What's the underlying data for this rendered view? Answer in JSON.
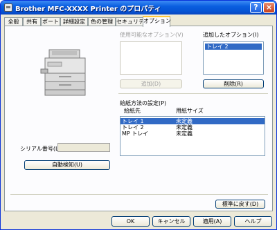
{
  "window": {
    "title": "Brother MFC-XXXX Printer のプロパティ"
  },
  "titlebar_buttons": {
    "help": "?",
    "close": "×"
  },
  "tabs": [
    "全般",
    "共有",
    "ポート",
    "詳細設定",
    "色の管理",
    "セキュリティ",
    "オプション"
  ],
  "active_tab": "オプション",
  "options": {
    "available_label": "使用可能なオプション(V)",
    "added_label": "追加したオプション(I)",
    "available_items": [],
    "added_items": [
      "トレイ 2"
    ],
    "add_button": "追加(D)",
    "remove_button": "削除(R)"
  },
  "paper_source": {
    "label": "給紙方法の設定(P)",
    "col_source": "給紙先",
    "col_size": "用紙サイズ",
    "rows": [
      {
        "source": "トレイ 1",
        "size": "未定義",
        "selected": true
      },
      {
        "source": "トレイ 2",
        "size": "未定義",
        "selected": false
      },
      {
        "source": "MP トレイ",
        "size": "未定義",
        "selected": false
      }
    ]
  },
  "serial": {
    "label": "シリアル番号(L)",
    "value": ""
  },
  "auto_detect_button": "自動検知(U)",
  "defaults_button": "標準に戻す(D)",
  "footer": {
    "ok": "OK",
    "cancel": "キャンセル",
    "apply": "適用(A)",
    "help": "ヘルプ"
  }
}
